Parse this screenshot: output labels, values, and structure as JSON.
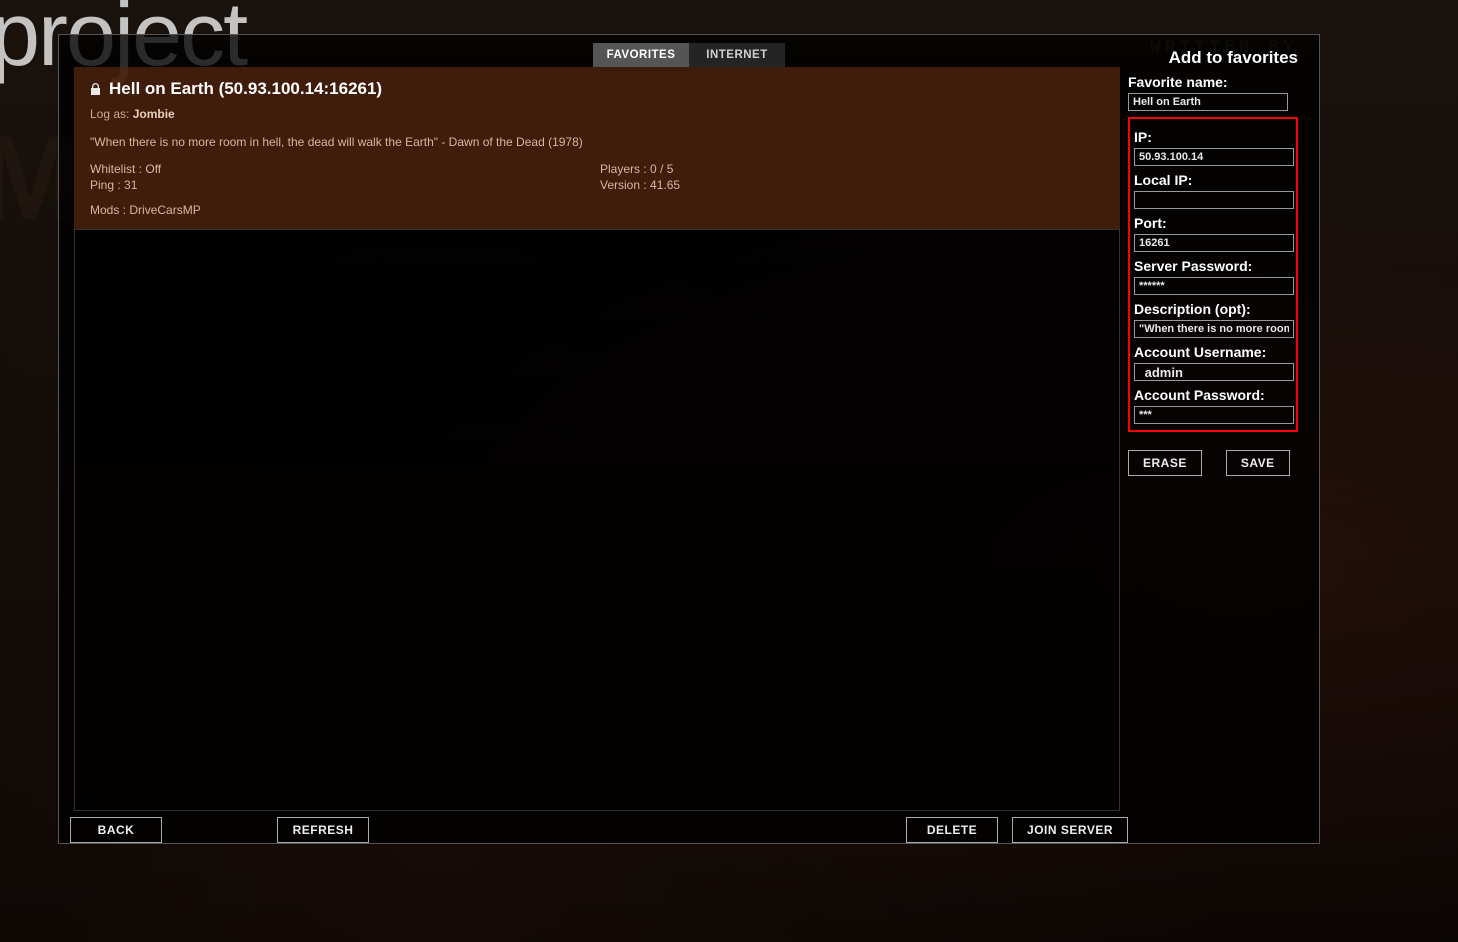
{
  "background": {
    "title1": "project",
    "title2": "MBOID",
    "written": "WRITTEN BY"
  },
  "tabs": {
    "favorites": "FAVORITES",
    "internet": "INTERNET"
  },
  "server": {
    "title": "Hell on Earth (50.93.100.14:16261)",
    "log_as_label": "Log as:",
    "log_as_name": "Jombie",
    "description": "\"When there is no more room in hell, the dead will walk the Earth\" - Dawn of the Dead (1978)",
    "whitelist_label": "Whitelist :",
    "whitelist_value": "Off",
    "ping_label": "Ping :",
    "ping_value": "31",
    "players_label": "Players :",
    "players_value": "0 / 5",
    "version_label": "Version :",
    "version_value": "41.65",
    "mods_label": "Mods :",
    "mods_value": "DriveCarsMP"
  },
  "form": {
    "title": "Add to favorites",
    "favorite_name_label": "Favorite name:",
    "favorite_name_value": "Hell on Earth",
    "ip_label": "IP:",
    "ip_value": "50.93.100.14",
    "local_ip_label": "Local IP:",
    "local_ip_value": "",
    "port_label": "Port:",
    "port_value": "16261",
    "server_password_label": "Server Password:",
    "server_password_value": "******",
    "description_label": "Description (opt):",
    "description_value": "\"When there is no more room in",
    "account_username_label": "Account Username:",
    "account_username_value": " admin",
    "account_password_label": "Account Password:",
    "account_password_value": "***",
    "erase": "ERASE",
    "save": "SAVE"
  },
  "bottom": {
    "back": "BACK",
    "refresh": "REFRESH",
    "delete": "DELETE",
    "join": "JOIN SERVER"
  }
}
